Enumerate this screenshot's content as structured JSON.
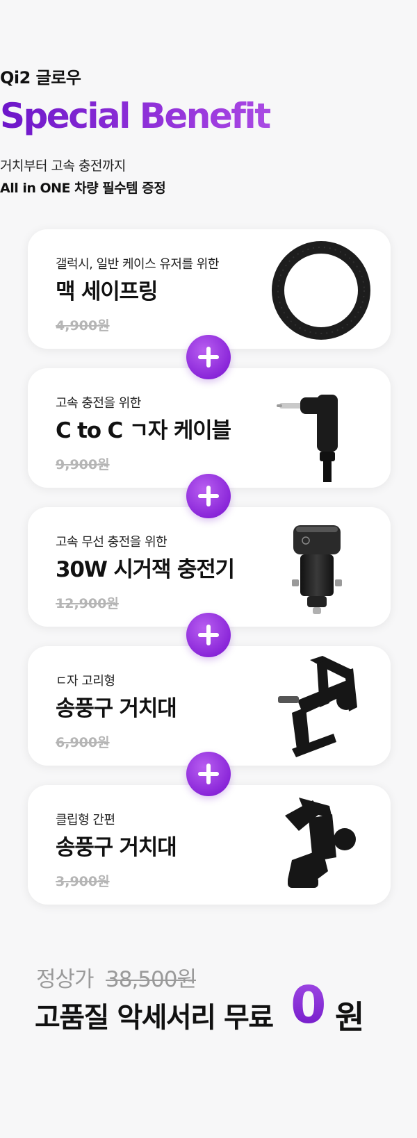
{
  "header": {
    "eyebrow": "Qi2 글로우",
    "headline": "Special Benefit",
    "sub1": "거치부터 고속 충전까지",
    "sub2": "All in ONE 차량 필수템 증정"
  },
  "items": [
    {
      "caption": "갤럭시, 일반 케이스 유저를 위한",
      "name": "맥 세이프링",
      "price": "4,900원",
      "image_icon": "magsafe-ring-icon"
    },
    {
      "caption": "고속 충전을 위한",
      "name": "C to C ㄱ자 케이블",
      "price": "9,900원",
      "image_icon": "usb-c-cable-icon"
    },
    {
      "caption": "고속 무선 충전을 위한",
      "name": "30W 시거잭 충전기",
      "price": "12,900원",
      "image_icon": "car-charger-icon"
    },
    {
      "caption": "ㄷ자 고리형",
      "name": "송풍구 거치대",
      "price": "6,900원",
      "image_icon": "vent-mount-hook-icon"
    },
    {
      "caption": "클립형 간편",
      "name": "송풍구 거치대",
      "price": "3,900원",
      "image_icon": "vent-mount-clip-icon"
    }
  ],
  "summary": {
    "orig_label": "정상가",
    "orig_price": "38,500원",
    "free_text": "고품질 악세서리 무료",
    "zero": "0",
    "won": "원"
  },
  "colors": {
    "accent": "#8a26d9",
    "background": "#f7f7f8"
  }
}
